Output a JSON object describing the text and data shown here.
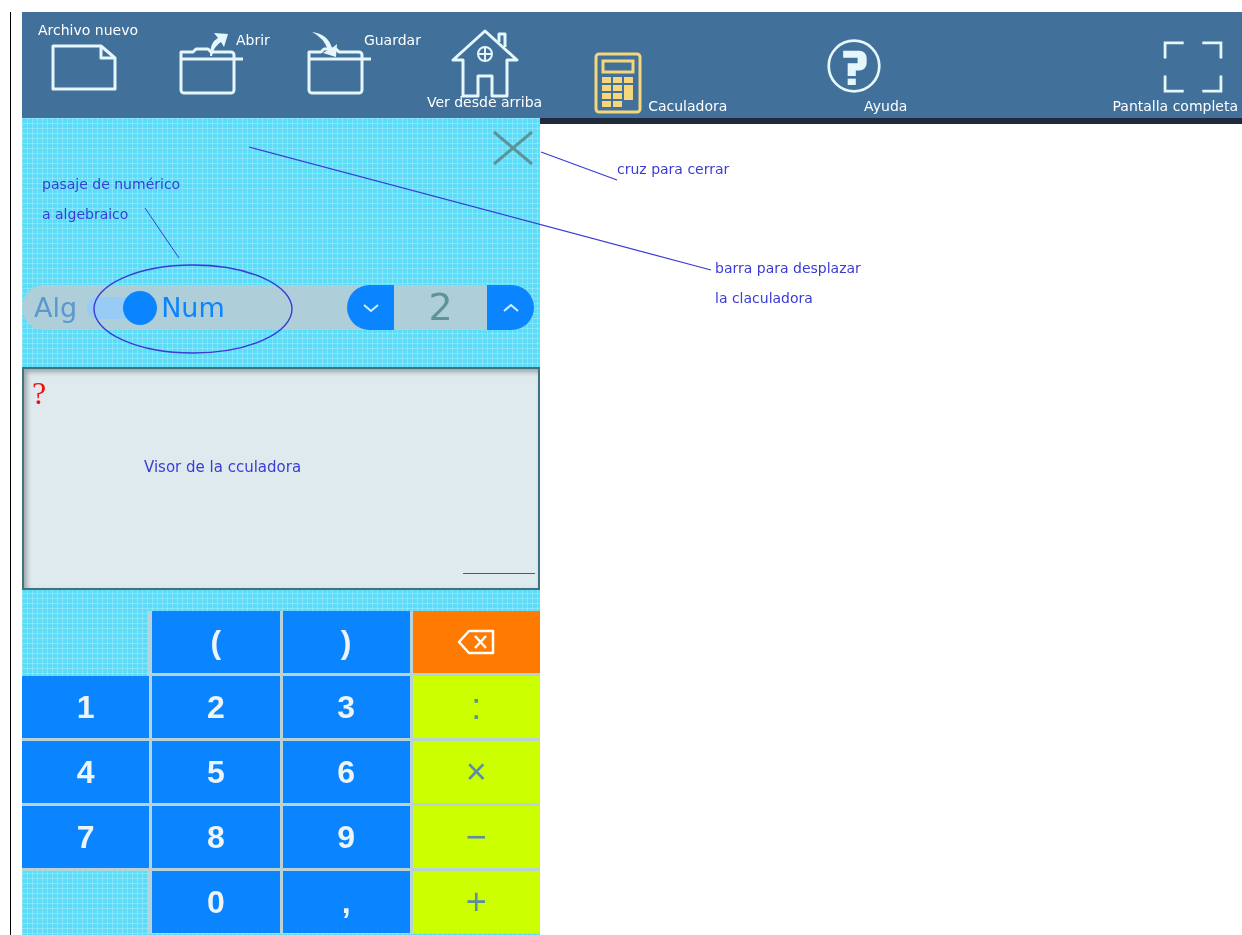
{
  "toolbar": {
    "items": [
      {
        "kind": "new",
        "label": "Archivo nuevo",
        "selected": false
      },
      {
        "kind": "open",
        "label": "Abrir",
        "selected": false
      },
      {
        "kind": "save",
        "label": "Guardar",
        "selected": false
      },
      {
        "kind": "home",
        "label": "Ver desde arriba",
        "selected": false
      },
      {
        "kind": "calculator",
        "label": "Caculadora",
        "selected": true
      },
      {
        "kind": "help",
        "label": "Ayuda",
        "selected": false
      },
      {
        "kind": "fullscreen",
        "label": "Pantalla completa",
        "selected": false
      }
    ]
  },
  "calculator": {
    "mode": {
      "options": [
        {
          "label": "Alg",
          "selected": false
        },
        {
          "label": "Num",
          "selected": true
        }
      ]
    },
    "precision": {
      "value": "2"
    },
    "display": {
      "error_mark": "?",
      "note": "Visor de la cculadora"
    },
    "keys": [
      [
        {
          "kind": "empty"
        },
        {
          "kind": "input",
          "label": "("
        },
        {
          "kind": "input",
          "label": ")"
        },
        {
          "kind": "delete"
        }
      ],
      [
        {
          "kind": "input",
          "label": "1"
        },
        {
          "kind": "input",
          "label": "2"
        },
        {
          "kind": "input",
          "label": "3"
        },
        {
          "kind": "operator",
          "label": ":"
        }
      ],
      [
        {
          "kind": "input",
          "label": "4"
        },
        {
          "kind": "input",
          "label": "5"
        },
        {
          "kind": "input",
          "label": "6"
        },
        {
          "kind": "operator",
          "label": "×"
        }
      ],
      [
        {
          "kind": "input",
          "label": "7"
        },
        {
          "kind": "input",
          "label": "8"
        },
        {
          "kind": "input",
          "label": "9"
        },
        {
          "kind": "operator",
          "label": "−"
        }
      ],
      [
        {
          "kind": "empty"
        },
        {
          "kind": "input",
          "label": "0"
        },
        {
          "kind": "input",
          "label": ","
        },
        {
          "kind": "operator",
          "label": "+"
        }
      ]
    ]
  },
  "annotations": [
    {
      "lines": [
        "cruz para cerrar"
      ]
    },
    {
      "lines": [
        "barra para desplazar",
        "la claculadora"
      ]
    },
    {
      "lines": [
        "pasaje de numérico",
        "a algebraico"
      ]
    }
  ]
}
